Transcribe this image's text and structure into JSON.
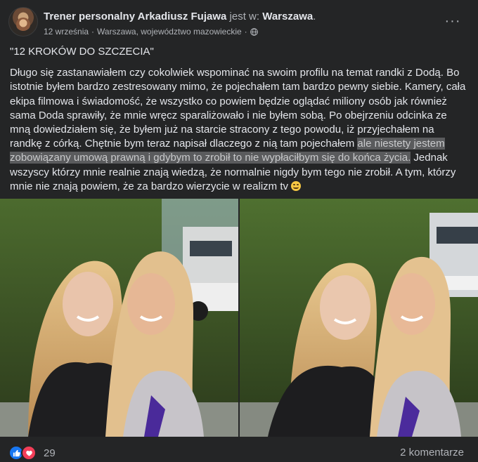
{
  "header": {
    "author": "Trener personalny Arkadiusz Fujawa",
    "at_text": "jest w:",
    "place": "Warszawa",
    "dot": ".",
    "date": "12 września",
    "separator": "·",
    "location": "Warszawa, województwo mazowieckie",
    "separator2": "·",
    "audience_icon": "globe-icon",
    "more_label": "···"
  },
  "post": {
    "headline": "\"12 KROKÓW DO SZCZECIA\"",
    "body_part1": "Długo się zastanawiałem czy cokolwiek wspominać na swoim profilu na temat randki z Dodą. Bo istotnie byłem bardzo zestresowany mimo, że pojechałem tam bardzo pewny siebie. Kamery, cała ekipa filmowa i świadomość, że wszystko co powiem będzie oglądać miliony osób jak również sama Doda sprawiły, że mnie wręcz sparaliżowało i nie byłem sobą. Po obejrzeniu odcinka ze mną dowiedziałem się, że byłem już na starcie stracony z tego powodu, iż przyjechałem na randkę z córką. Chętnie bym teraz napisał dlaczego z nią tam pojechałem ",
    "body_highlight": "ale niestety jestem zobowiązany umową prawną i gdybym to zrobił to nie wypłaciłbym się do końca życia.",
    "body_part2": " Jednak wszyscy którzy mnie realnie znają wiedzą, że normalnie nigdy bym tego nie zrobił. A tym,  którzy mnie nie znają powiem, że za bardzo wierzycie w realizm tv "
  },
  "footer": {
    "reaction_count": "29",
    "comments_label": "2 komentarze"
  },
  "colors": {
    "background": "#242526",
    "text": "#e4e6eb",
    "secondary_text": "#b0b3b8",
    "like_blue": "#1877f2",
    "love_red": "#f33e58",
    "highlight": "#5a5b5d"
  }
}
